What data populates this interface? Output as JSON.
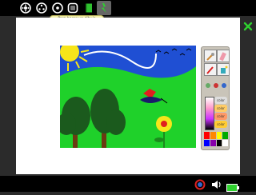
{
  "toolbar": {
    "icons": [
      "settings-gear-icon",
      "activity-circle-icon",
      "journal-circle-icon",
      "frame-icon",
      "green-book-icon",
      "painting-activity-icon"
    ],
    "hint_text": "Para hacer un dibujo"
  },
  "palette": {
    "tools": [
      "brush-icon",
      "eraser-icon",
      "pencil-icon",
      "bucket-icon"
    ],
    "colors": [
      "#ff0000",
      "#ff8800",
      "#ffff00",
      "#00aa00",
      "#0000ff",
      "#8800aa",
      "#000000",
      "#ffffff"
    ],
    "swatch_labels": [
      "color",
      "color",
      "color",
      "color"
    ]
  },
  "status": {
    "icons": [
      "network-icon",
      "speaker-icon",
      "battery-icon"
    ],
    "right_icon": "close-x-icon"
  },
  "colors": {
    "sky": "#1f4fd3",
    "grass": "#1fd12a",
    "sun": "#f7e51a",
    "tree": "#1b5a1d"
  }
}
